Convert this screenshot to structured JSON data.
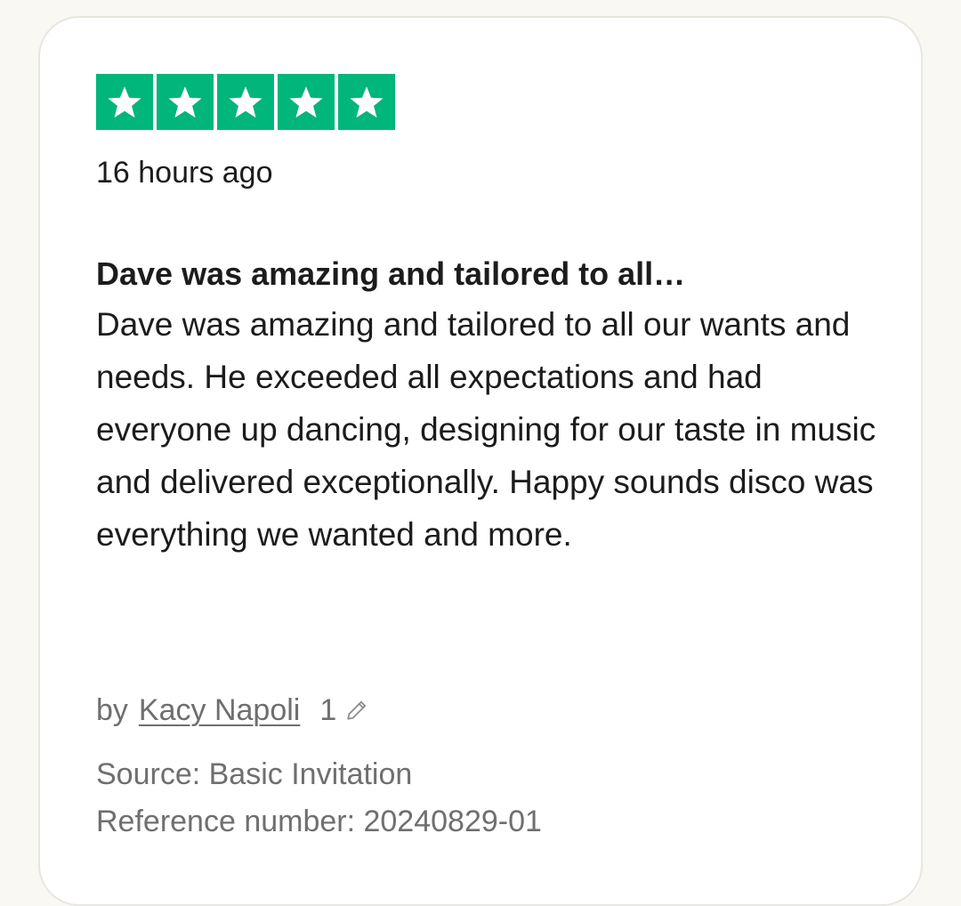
{
  "review": {
    "rating": 5,
    "rating_max": 5,
    "star_color": "#00b67a",
    "star_icon": "star-icon",
    "date": "16 hours ago",
    "title": "Dave was amazing and tailored to all…",
    "body": "Dave was amazing and tailored to all our wants and needs. He exceeded all expectations and had everyone up dancing, designing for our taste in music and delivered exceptionally. Happy sounds disco was everything we wanted and more.",
    "by_label": "by",
    "author": "Kacy Napoli",
    "review_count": "1",
    "review_count_icon": "pencil-icon",
    "source": "Source: Basic Invitation",
    "reference": "Reference number: 20240829-01"
  }
}
